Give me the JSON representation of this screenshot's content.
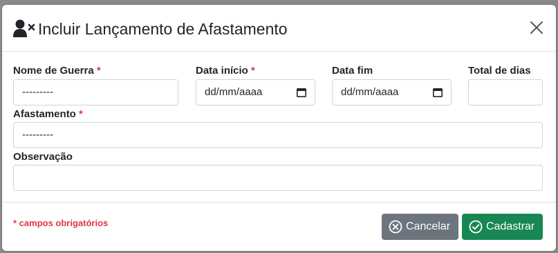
{
  "modal": {
    "title": "Incluir Lançamento de Afastamento",
    "title_icon": "user-times-icon",
    "close_icon": "close-icon"
  },
  "form": {
    "nome_guerra": {
      "label": "Nome de Guerra",
      "required_mark": "*",
      "value": "---------"
    },
    "data_inicio": {
      "label": "Data início",
      "required_mark": "*",
      "value": "dd/mm/aaaa",
      "icon": "calendar-icon"
    },
    "data_fim": {
      "label": "Data fim",
      "value": "dd/mm/aaaa",
      "icon": "calendar-icon"
    },
    "total_dias": {
      "label": "Total de dias",
      "value": ""
    },
    "afastamento": {
      "label": "Afastamento",
      "required_mark": "*",
      "value": "---------"
    },
    "observacao": {
      "label": "Observação",
      "value": ""
    }
  },
  "footer": {
    "required_note": "* campos obrigatórios",
    "cancel_label": "Cancelar",
    "cancel_icon": "circle-x-icon",
    "submit_label": "Cadastrar",
    "submit_icon": "circle-check-icon"
  },
  "colors": {
    "required": "#dc3545",
    "cancel_button": "#6c757d",
    "submit_button": "#198754"
  }
}
